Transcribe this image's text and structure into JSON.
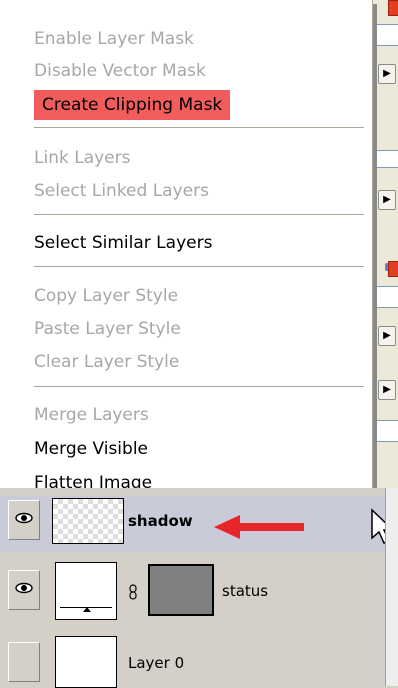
{
  "menu": {
    "items": [
      {
        "label": "Enable Layer Mask",
        "state": "disabled"
      },
      {
        "label": "Disable Vector Mask",
        "state": "disabled"
      },
      {
        "label": "Create Clipping Mask",
        "state": "highlighted"
      },
      {
        "label": "Link Layers",
        "state": "disabled"
      },
      {
        "label": "Select Linked Layers",
        "state": "disabled"
      },
      {
        "label": "Select Similar Layers",
        "state": "enabled"
      },
      {
        "label": "Copy Layer Style",
        "state": "disabled"
      },
      {
        "label": "Paste Layer Style",
        "state": "disabled"
      },
      {
        "label": "Clear Layer Style",
        "state": "disabled"
      },
      {
        "label": "Merge Layers",
        "state": "disabled"
      },
      {
        "label": "Merge Visible",
        "state": "enabled"
      },
      {
        "label": "Flatten Image",
        "state": "enabled"
      }
    ]
  },
  "layers": [
    {
      "name": "shadow",
      "visible": true,
      "selected": true,
      "thumbnail": "transparent",
      "has_mask": false
    },
    {
      "name": "status",
      "visible": true,
      "selected": false,
      "thumbnail": "white-with-bar",
      "has_mask": true,
      "linked": true
    },
    {
      "name": "Layer 0",
      "visible": false,
      "selected": false,
      "thumbnail": "white",
      "has_mask": false
    }
  ],
  "colors": {
    "highlight": "#f25c5c",
    "disabled_text": "#a7a6aa",
    "arrow": "#e8262a",
    "panel_bg": "#d4d0c8"
  },
  "icons": {
    "eye": "eye-icon",
    "chain": "link-chain-icon",
    "arrow": "red-arrow-annotation",
    "cursor": "mouse-cursor-icon"
  }
}
